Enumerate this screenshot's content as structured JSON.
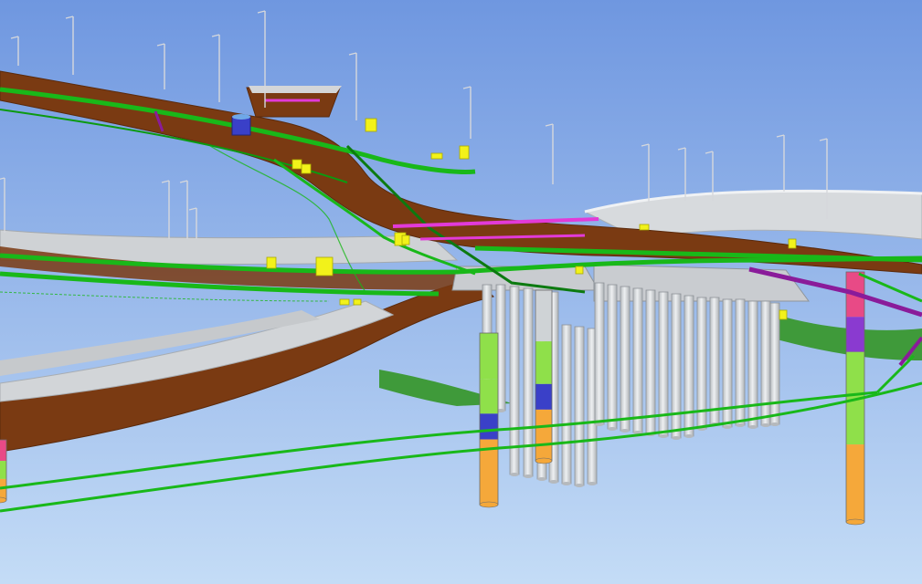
{
  "scene": {
    "colors": {
      "sky_top": "#6f97e0",
      "sky_bottom": "#c4dcf6",
      "road_surface": "#7a3a12",
      "road_edge": "#5a2a0c",
      "concrete": "#c9ccd0",
      "concrete_dark": "#9ea3a8",
      "ground_green": "#3f9a3a",
      "pipe_green": "#19b819",
      "pipe_dark": "#0c7a10",
      "magenta": "#e23ad8",
      "purple": "#8a1b9a",
      "yellow_box": "#f2f21a",
      "pile_orange": "#f5a83a",
      "pile_blue": "#3a40c8",
      "pile_lime": "#8fe04a",
      "pile_pink": "#e84a86",
      "pile_violet": "#8a3ad0",
      "pile_gray": "#cfd3d6",
      "lamp_pole": "#d6d8dc"
    },
    "icons": {
      "lamp_post": "street-light-icon",
      "utility_box": "utility-box-icon",
      "manhole": "manhole-icon"
    }
  }
}
